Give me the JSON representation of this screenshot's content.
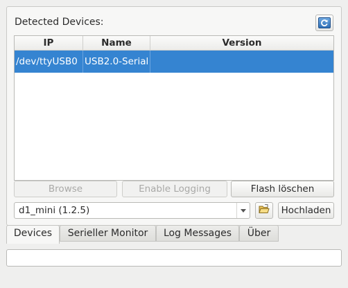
{
  "panel": {
    "title": "Detected Devices:",
    "refresh_icon": "refresh-icon"
  },
  "table": {
    "columns": [
      "IP",
      "Name",
      "Version"
    ],
    "rows": [
      {
        "ip": "/dev/ttyUSB0",
        "name": "USB2.0-Serial",
        "version": ""
      }
    ]
  },
  "buttons": {
    "browse": "Browse",
    "enable_logging": "Enable Logging",
    "flash_erase": "Flash löschen",
    "upload": "Hochladen"
  },
  "board_select": {
    "value": "d1_mini (1.2.5)"
  },
  "tabs": [
    "Devices",
    "Serieller Monitor",
    "Log Messages",
    "Über"
  ],
  "active_tab": "Devices",
  "status": {
    "value": ""
  },
  "colors": {
    "selection": "#3584d1",
    "background": "#efefee"
  }
}
